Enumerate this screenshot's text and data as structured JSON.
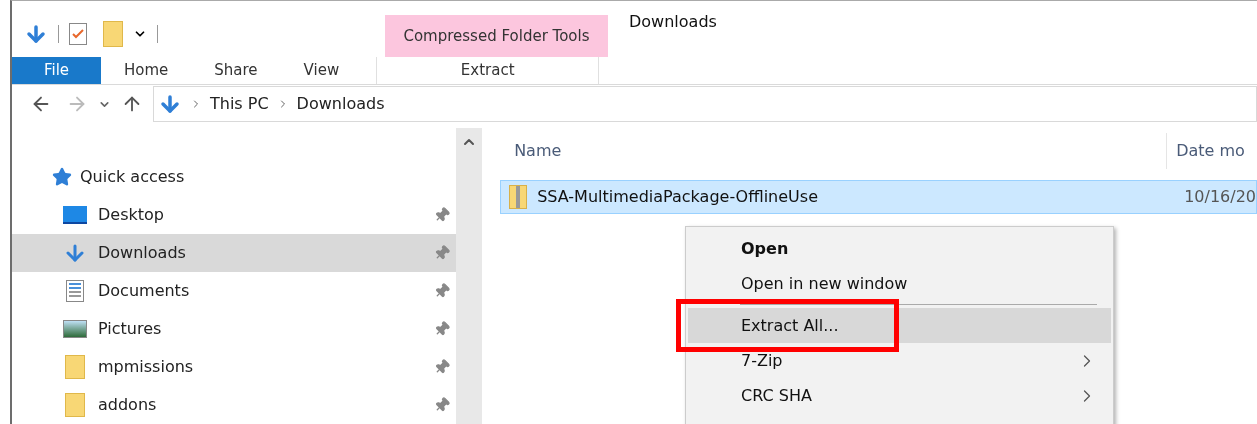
{
  "ribbon": {
    "context_group": "Compressed Folder Tools",
    "window_title": "Downloads",
    "tabs": [
      {
        "label": "File",
        "kind": "file"
      },
      {
        "label": "Home",
        "kind": "tab"
      },
      {
        "label": "Share",
        "kind": "tab"
      },
      {
        "label": "View",
        "kind": "tab"
      },
      {
        "label": "Extract",
        "kind": "context"
      }
    ]
  },
  "address_bar": {
    "path": [
      "This PC",
      "Downloads"
    ]
  },
  "navigation": {
    "header": "Quick access",
    "items": [
      {
        "label": "Desktop",
        "kind": "desktop",
        "selected": false,
        "pinned": true
      },
      {
        "label": "Downloads",
        "kind": "downloads",
        "selected": true,
        "pinned": true
      },
      {
        "label": "Documents",
        "kind": "documents",
        "selected": false,
        "pinned": true
      },
      {
        "label": "Pictures",
        "kind": "pictures",
        "selected": false,
        "pinned": true
      },
      {
        "label": "mpmissions",
        "kind": "folder",
        "selected": false,
        "pinned": true
      },
      {
        "label": "addons",
        "kind": "folder",
        "selected": false,
        "pinned": true
      }
    ]
  },
  "file_list": {
    "columns": [
      "Name",
      "Date mo"
    ],
    "rows": [
      {
        "name": "SSA-MultimediaPackage-OfflineUse",
        "date": "10/16/20",
        "selected": true
      }
    ]
  },
  "context_menu": {
    "items": [
      {
        "kind": "item",
        "label": "Open",
        "bold": true,
        "selected": false,
        "submenu": false,
        "highlighted_frame": false
      },
      {
        "kind": "item",
        "label": "Open in new window",
        "bold": false,
        "selected": false,
        "submenu": false,
        "highlighted_frame": false
      },
      {
        "kind": "separator"
      },
      {
        "kind": "item",
        "label": "Extract All...",
        "bold": false,
        "selected": true,
        "submenu": false,
        "highlighted_frame": true
      },
      {
        "kind": "item",
        "label": "7-Zip",
        "bold": false,
        "selected": false,
        "submenu": true,
        "highlighted_frame": false
      },
      {
        "kind": "item",
        "label": "CRC SHA",
        "bold": false,
        "selected": false,
        "submenu": true,
        "highlighted_frame": false
      }
    ]
  }
}
